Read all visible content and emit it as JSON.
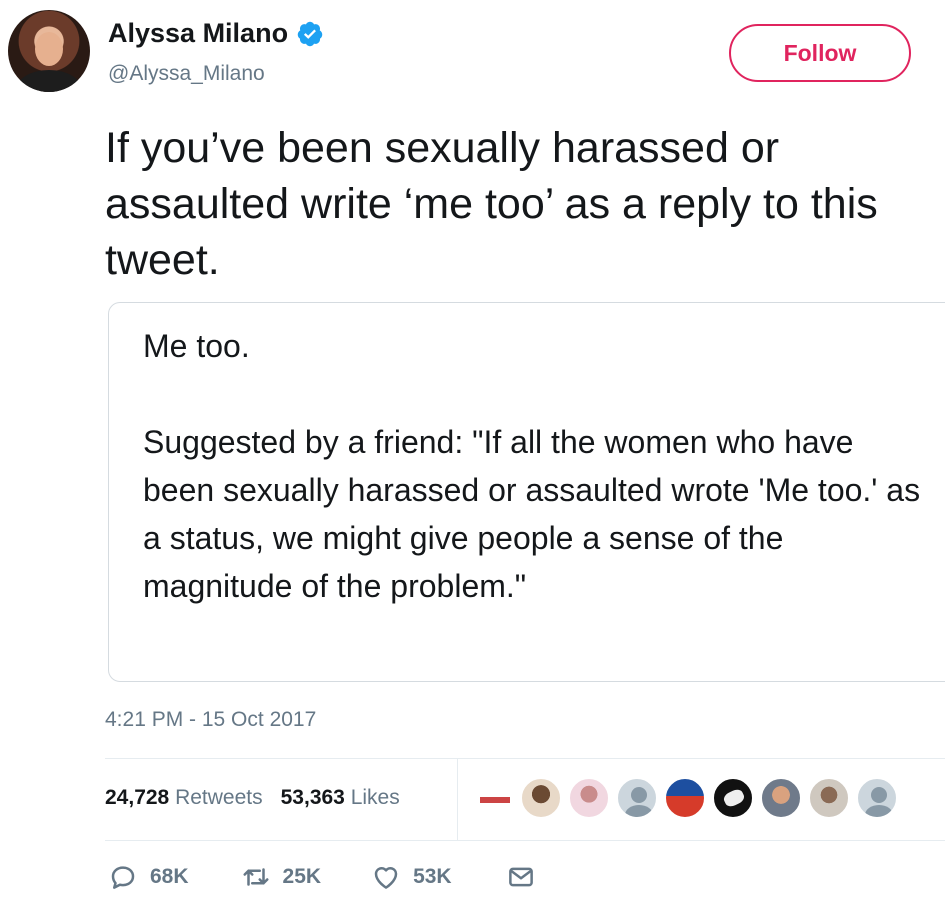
{
  "author": {
    "name": "Alyssa Milano",
    "handle": "@Alyssa_Milano",
    "verified": true,
    "avatar_icon": "profile-photo"
  },
  "follow_button": {
    "label": "Follow",
    "color": "#e0245e"
  },
  "tweet": {
    "text": "If you’ve been sexually harassed or assaulted write ‘me too’ as a reply to this tweet.",
    "attached_text": "Me too.\n\nSuggested by a friend: \"If all the women who have been sexually harassed or assaulted wrote 'Me too.' as a status, we might give people a sense of the magnitude of the problem.\"",
    "timestamp": "4:21 PM - 15 Oct 2017"
  },
  "stats": {
    "retweets_count": "24,728",
    "retweets_label": "Retweets",
    "likes_count": "53,363",
    "likes_label": "Likes"
  },
  "liker_avatars": [
    "avatar-1",
    "avatar-2",
    "avatar-3",
    "default-avatar",
    "avatar-5",
    "avatar-6",
    "avatar-7",
    "avatar-8",
    "default-avatar"
  ],
  "actions": {
    "reply_count": "68K",
    "retweet_count": "25K",
    "like_count": "53K"
  },
  "colors": {
    "text": "#14171a",
    "secondary": "#657786",
    "verified": "#1da1f2",
    "border": "#e6ecf0"
  }
}
